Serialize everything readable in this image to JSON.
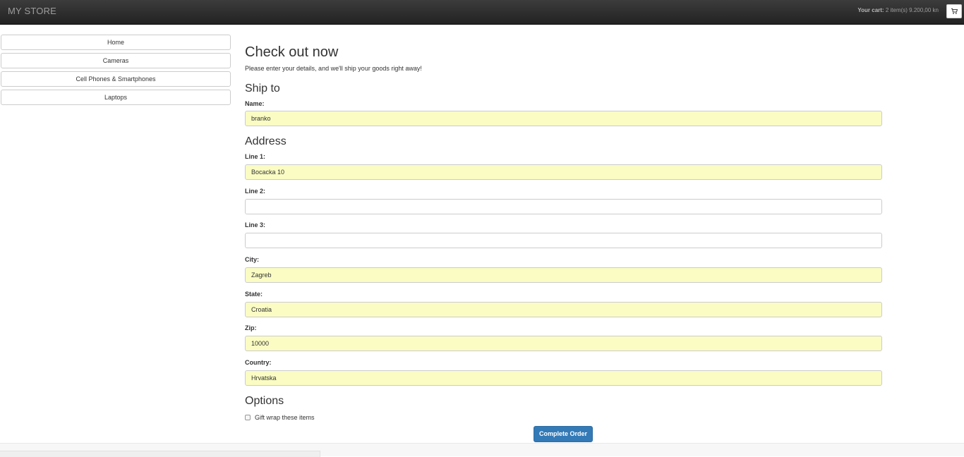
{
  "navbar": {
    "brand": "MY STORE",
    "cart": {
      "label": "Your cart:",
      "summary": "2 item(s) 9.200,00 kn",
      "icon": "shopping-cart-icon"
    }
  },
  "categories": [
    {
      "label": "Home"
    },
    {
      "label": "Cameras"
    },
    {
      "label": "Cell Phones & Smartphones"
    },
    {
      "label": "Laptops"
    }
  ],
  "checkout": {
    "title": "Check out now",
    "lead": "Please enter your details, and we'll ship your goods right away!",
    "ship_to": {
      "heading": "Ship to",
      "name_label": "Name:",
      "name_value": "branko"
    },
    "address": {
      "heading": "Address",
      "line1_label": "Line 1:",
      "line1_value": "Bocacka 10",
      "line2_label": "Line 2:",
      "line2_value": "",
      "line3_label": "Line 3:",
      "line3_value": "",
      "city_label": "City:",
      "city_value": "Zagreb",
      "state_label": "State:",
      "state_value": "Croatia",
      "zip_label": "Zip:",
      "zip_value": "10000",
      "country_label": "Country:",
      "country_value": "Hrvatska"
    },
    "options": {
      "heading": "Options",
      "gift_wrap_label": "Gift wrap these items",
      "gift_wrap_checked": false
    },
    "submit_label": "Complete Order"
  },
  "colors": {
    "navbar": "#222222",
    "autofill": "#fafcc3",
    "primary": "#337ab7"
  }
}
